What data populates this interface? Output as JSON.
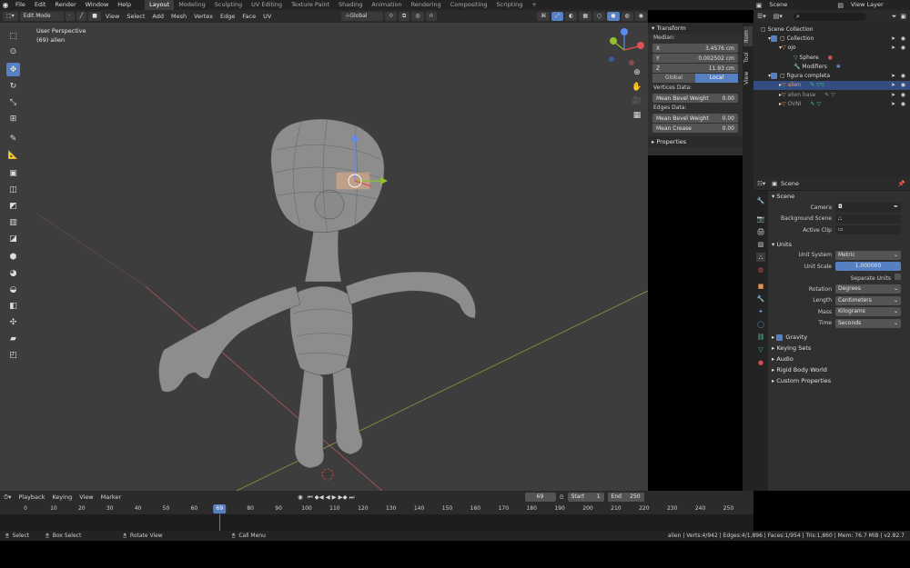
{
  "topbar": {
    "menus": [
      "File",
      "Edit",
      "Render",
      "Window",
      "Help"
    ],
    "workspaces": [
      "Layout",
      "Modeling",
      "Sculpting",
      "UV Editing",
      "Texture Paint",
      "Shading",
      "Animation",
      "Rendering",
      "Compositing",
      "Scripting"
    ],
    "active_workspace": "Layout",
    "add_tab": "+",
    "scene": "Scene",
    "view_layer": "View Layer"
  },
  "viewport_header": {
    "mode": "Edit Mode",
    "menus": [
      "View",
      "Select",
      "Add",
      "Mesh",
      "Vertex",
      "Edge",
      "Face",
      "UV"
    ],
    "transform_orientation": "Global"
  },
  "viewport": {
    "view_name": "User Perspective",
    "object_label": "(69) alien"
  },
  "npanel": {
    "transform_title": "Transform",
    "median_label": "Median:",
    "fields": [
      {
        "label": "X",
        "value": "3.4576 cm"
      },
      {
        "label": "Y",
        "value": "0.002502 cm"
      },
      {
        "label": "Z",
        "value": "11.93 cm"
      }
    ],
    "toggle": [
      "Global",
      "Local"
    ],
    "vertices_label": "Vertices Data:",
    "vertices_fields": [
      {
        "label": "Mean Bevel Weight",
        "value": "0.00"
      }
    ],
    "edges_label": "Edges Data:",
    "edges_fields": [
      {
        "label": "Mean Bevel Weight",
        "value": "0.00"
      },
      {
        "label": "Mean Crease",
        "value": "0.00"
      }
    ],
    "properties_title": "Properties",
    "side_tabs": [
      "Item",
      "Tool",
      "View"
    ]
  },
  "outliner": {
    "rows": [
      {
        "name": "Scene Collection",
        "indent": 0
      },
      {
        "name": "Collection",
        "indent": 1
      },
      {
        "name": "ojo",
        "indent": 2
      },
      {
        "name": "Sphere",
        "indent": 3
      },
      {
        "name": "Modifiers",
        "indent": 3
      },
      {
        "name": "figura completa",
        "indent": 1
      },
      {
        "name": "alien",
        "indent": 2,
        "selected": true
      },
      {
        "name": "alien base",
        "indent": 2
      },
      {
        "name": "OVNI",
        "indent": 2
      }
    ]
  },
  "properties": {
    "header": "Scene",
    "scene_section": "Scene",
    "camera_label": "Camera",
    "bg_scene_label": "Background Scene",
    "active_clip_label": "Active Clip",
    "units_section": "Units",
    "unit_system_label": "Unit System",
    "unit_system": "Metric",
    "unit_scale_label": "Unit Scale",
    "unit_scale": "1.000000",
    "separate_units": "Separate Units",
    "rotation_label": "Rotation",
    "rotation": "Degrees",
    "length_label": "Length",
    "length": "Centimeters",
    "mass_label": "Mass",
    "mass": "Kilograms",
    "time_label": "Time",
    "time": "Seconds",
    "gravity": "Gravity",
    "collapsed": [
      "Keying Sets",
      "Audio",
      "Rigid Body World",
      "Custom Properties"
    ]
  },
  "timeline": {
    "menus": [
      "Playback",
      "Keying",
      "View",
      "Marker"
    ],
    "current_frame": "69",
    "start_label": "Start",
    "start": "1",
    "end_label": "End",
    "end": "250",
    "ticks": [
      "0",
      "10",
      "20",
      "30",
      "40",
      "50",
      "60",
      "70",
      "80",
      "90",
      "100",
      "110",
      "120",
      "130",
      "140",
      "150",
      "160",
      "170",
      "180",
      "190",
      "200",
      "210",
      "220",
      "230",
      "240",
      "250"
    ]
  },
  "statusbar": {
    "select": "Select",
    "box_select": "Box Select",
    "rotate_view": "Rotate View",
    "call_menu": "Call Menu",
    "stats": "alien | Verts:4/942 | Edges:4/1,896 | Faces:1/954 | Tris:1,860 | Mem: 76.7 MiB | v2.82.7"
  }
}
